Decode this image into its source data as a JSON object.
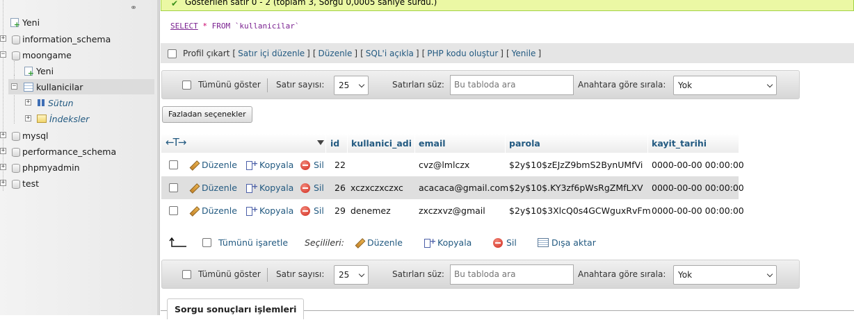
{
  "success": {
    "message": "Gösterilen satır 0 - 2 (toplam 3, Sorgu 0,0005 saniye sürdü.)"
  },
  "sql": {
    "select": "SELECT",
    "star": "*",
    "from": "FROM",
    "table": "`kullanicilar`"
  },
  "profile_bar": {
    "profile_label": "Profil çıkart",
    "links": [
      "Satır içi düzenle",
      "Düzenle",
      "SQL'i açıkla",
      "PHP kodu oluştur",
      "Yenile"
    ]
  },
  "navbar": {
    "show_all_label": "Tümünü göster",
    "row_count_label": "Satır sayısı:",
    "row_count_value": "25",
    "filter_label": "Satırları süz:",
    "filter_placeholder": "Bu tabloda ara",
    "sort_label": "Anahtara göre sırala:",
    "sort_value": "Yok"
  },
  "more_options_label": "Fazladan seçenekler",
  "tree": {
    "items": [
      {
        "label": "Yeni"
      },
      {
        "label": "information_schema"
      },
      {
        "label": "moongame"
      },
      {
        "label": "Yeni"
      },
      {
        "label": "kullanicilar"
      },
      {
        "label": "Sütun"
      },
      {
        "label": "İndeksler"
      },
      {
        "label": "mysql"
      },
      {
        "label": "performance_schema"
      },
      {
        "label": "phpmyadmin"
      },
      {
        "label": "test"
      }
    ]
  },
  "table": {
    "columns": [
      "id",
      "kullanici_adi",
      "email",
      "parola",
      "kayit_tarihi"
    ],
    "actions": {
      "edit": "Düzenle",
      "copy": "Kopyala",
      "delete": "Sil"
    },
    "rows": [
      {
        "id": "22",
        "kullanici_adi": "",
        "email": "cvz@lmlczx",
        "parola": "$2y$10$zEJzZ9bmS2BynUMfVi",
        "kayit_tarihi": "0000-00-00 00:00:00"
      },
      {
        "id": "26",
        "kullanici_adi": "xczxczxczxc",
        "email": "acacaca@gmail.com",
        "parola": "$2y$10$.KY3zf6pWsRgZMfLXV",
        "kayit_tarihi": "0000-00-00 00:00:00"
      },
      {
        "id": "29",
        "kullanici_adi": "denemez",
        "email": "zxczxvz@gmail",
        "parola": "$2y$10$3XlcQ0s4GCWguxRvFm",
        "kayit_tarihi": "0000-00-00 00:00:00"
      }
    ]
  },
  "bulk": {
    "check_all": "Tümünü işaretle",
    "selected": "Seçilileri:",
    "edit": "Düzenle",
    "copy": "Kopyala",
    "delete": "Sil",
    "export": "Dışa aktar"
  },
  "bottom_tab": "Sorgu sonuçları işlemleri"
}
